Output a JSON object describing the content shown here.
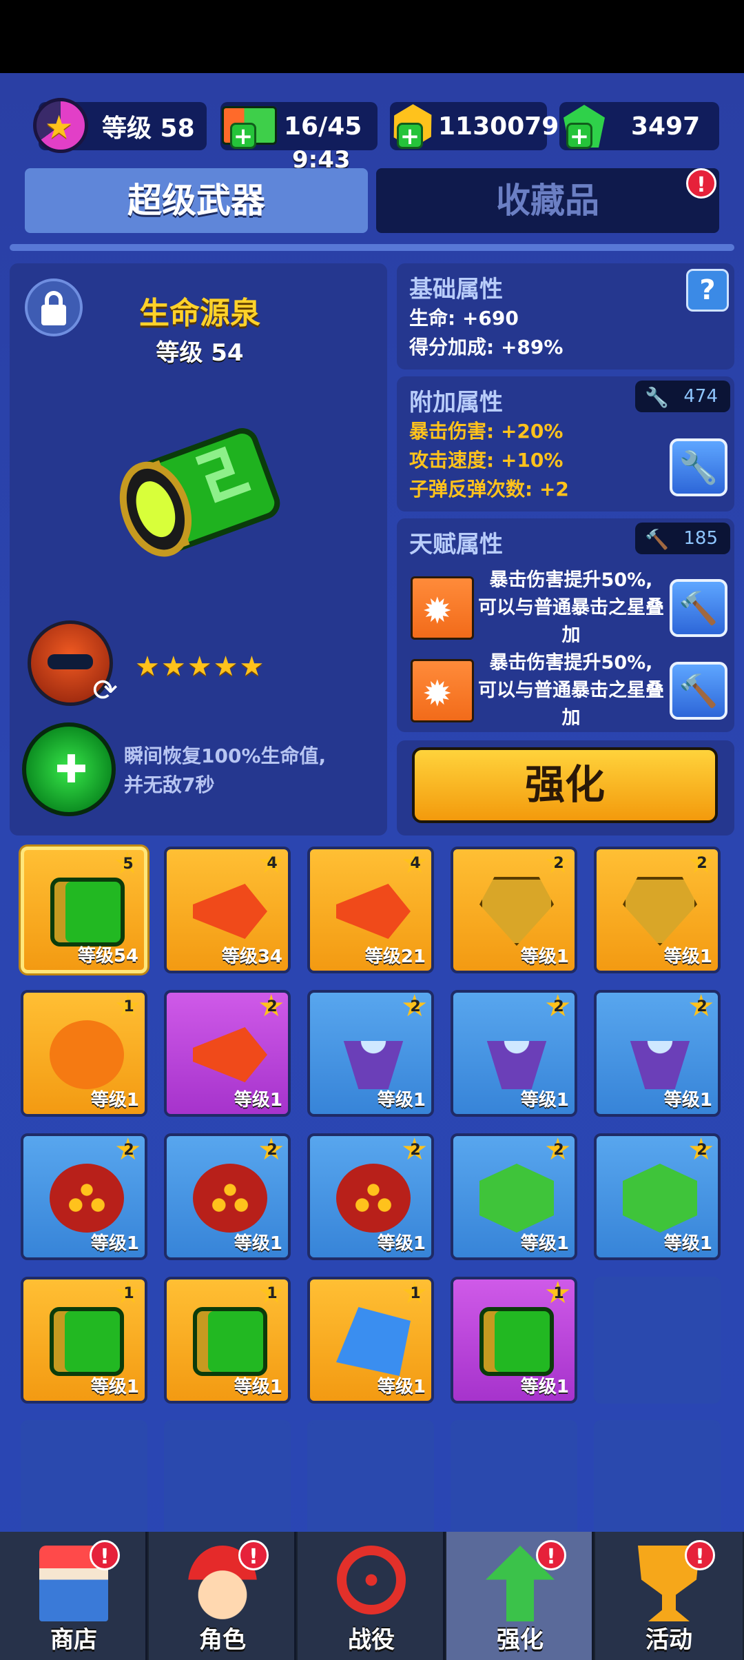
{
  "resources": {
    "level_label": "等级 58",
    "energy": "16/45",
    "energy_timer": "9:43",
    "gold": "1130079",
    "gems": "3497"
  },
  "tabs": {
    "super_weapons": "超级武器",
    "collectibles": "收藏品",
    "collectibles_alert": "!"
  },
  "weapon": {
    "name": "生命源泉",
    "level": "等级 54",
    "stars": "★★★★★",
    "skill_desc_line1": "瞬间恢复100%生命值,",
    "skill_desc_line2": "并无敌7秒"
  },
  "base_attrs": {
    "title": "基础属性",
    "help": "?",
    "hp": "生命: +690",
    "score_bonus": "得分加成: +89%"
  },
  "extra_attrs": {
    "title": "附加属性",
    "counter": "474",
    "crit_damage": "暴击伤害: +20%",
    "attack_speed": "攻击速度: +10%",
    "bullet_bounces": "子弹反弹次数: +2"
  },
  "talent_attrs": {
    "title": "天赋属性",
    "counter": "185",
    "talent1_l1": "暴击伤害提升50%,",
    "talent1_l2": "可以与普通暴击之星叠",
    "talent1_l3": "加",
    "talent2_l1": "暴击伤害提升50%,",
    "talent2_l2": "可以与普通暴击之星叠",
    "talent2_l3": "加"
  },
  "enhance_button": "强化",
  "inventory": [
    {
      "level": "等级54",
      "stars": "5",
      "rarity": "orange",
      "icon": "green-pipe-icon"
    },
    {
      "level": "等级34",
      "stars": "4",
      "rarity": "orange",
      "icon": "rocket-icon"
    },
    {
      "level": "等级21",
      "stars": "4",
      "rarity": "orange",
      "icon": "rocket-icon"
    },
    {
      "level": "等级1",
      "stars": "2",
      "rarity": "orange",
      "icon": "gold-shield-icon"
    },
    {
      "level": "等级1",
      "stars": "2",
      "rarity": "orange",
      "icon": "gold-shield-icon"
    },
    {
      "level": "等级1",
      "stars": "1",
      "rarity": "orange",
      "icon": "pumpkin-icon"
    },
    {
      "level": "等级1",
      "stars": "2",
      "rarity": "purple",
      "icon": "rocket-icon"
    },
    {
      "level": "等级1",
      "stars": "2",
      "rarity": "blue",
      "icon": "lightning-crystal-icon"
    },
    {
      "level": "等级1",
      "stars": "2",
      "rarity": "blue",
      "icon": "lightning-crystal-icon"
    },
    {
      "level": "等级1",
      "stars": "2",
      "rarity": "blue",
      "icon": "lightning-crystal-icon"
    },
    {
      "level": "等级1",
      "stars": "2",
      "rarity": "blue",
      "icon": "red-orb-icon"
    },
    {
      "level": "等级1",
      "stars": "2",
      "rarity": "blue",
      "icon": "red-orb-icon"
    },
    {
      "level": "等级1",
      "stars": "2",
      "rarity": "blue",
      "icon": "red-orb-icon"
    },
    {
      "level": "等级1",
      "stars": "2",
      "rarity": "blue",
      "icon": "green-cubes-icon"
    },
    {
      "level": "等级1",
      "stars": "2",
      "rarity": "blue",
      "icon": "green-cubes-icon"
    },
    {
      "level": "等级1",
      "stars": "1",
      "rarity": "orange",
      "icon": "green-pipe-icon"
    },
    {
      "level": "等级1",
      "stars": "1",
      "rarity": "orange",
      "icon": "green-pipe-icon"
    },
    {
      "level": "等级1",
      "stars": "1",
      "rarity": "orange",
      "icon": "blue-crystal-icon"
    },
    {
      "level": "等级1",
      "stars": "1",
      "rarity": "purple",
      "icon": "green-pipe-icon"
    }
  ],
  "nav": {
    "shop": "商店",
    "character": "角色",
    "campaign": "战役",
    "enhance": "强化",
    "events": "活动",
    "alert": "!"
  }
}
